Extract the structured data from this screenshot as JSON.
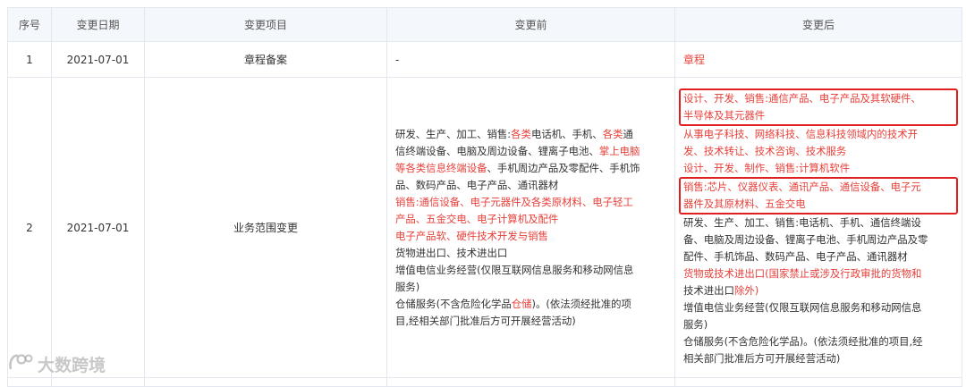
{
  "headers": [
    "序号",
    "变更日期",
    "变更项目",
    "变更前",
    "变更后"
  ],
  "rows": [
    {
      "index": "1",
      "date": "2021-07-01",
      "item": "章程备案",
      "before_text": "-",
      "after_text": "章程"
    },
    {
      "index": "2",
      "date": "2021-07-01",
      "item": "业务范围变更",
      "before": {
        "l1a": "研发、生产、加工、销售:",
        "l1b": "各类",
        "l1c": "电话机、手机、",
        "l1d": "各类",
        "l1e": "通",
        "l2a": "信终端设备、电脑及周边设备、锂离子电池、",
        "l2b": "掌上电脑",
        "l3a": "等各类信息终端设备",
        "l3b": "、手机周边产品及零配件、手机饰",
        "l4": "品、数码产品、电子产品、通讯器材",
        "l5": "销售:通信设备、电子元器件及各类原材料、电子轻工",
        "l6": "产品、五金交电、电子计算机及配件",
        "l7": "电子产品软、硬件技术开发与销售",
        "l8": "货物进出口、技术进出口",
        "l9": "增值电信业务经营(仅限互联网信息服务和移动网信息",
        "l10": "服务)",
        "l11a": "仓储服务(不含危险化学品",
        "l11b": "仓储",
        "l11c": ")。(依法须经批准的项",
        "l12": "目,经相关部门批准后方可开展经营活动)"
      },
      "after": {
        "box1_l1": "设计、开发、销售:通信产品、电子产品及其软硬件、",
        "box1_l2": "半导体及其元器件",
        "l3": "从事电子科技、网络科技、信息科技领域内的技术开",
        "l4": "发、技术转让、技术咨询、技术服务",
        "l5": "设计、开发、制作、销售:计算机软件",
        "box2_l1": "销售:芯片、仪器仪表、通讯产品、通信设备、电子元",
        "box2_l2": "器件及其原材料、五金交电",
        "l8": "研发、生产、加工、销售:电话机、手机、通信终端设",
        "l9": "备、电脑及周边设备、锂离子电池、手机周边产品及零",
        "l10": "配件、手机饰品、数码产品、电子产品、通讯器材",
        "l11": "货物或技术进出口(国家禁止或涉及行政审批的货物和",
        "l12a": "技术进出口",
        "l12b": "除外)",
        "l13": "增值电信业务经营(仅限互联网信息服务和移动网信息",
        "l14": "服务)",
        "l15": "仓储服务(不含危险化学品)。(依法须经批准的项目,经",
        "l16": "相关部门批准后方可开展经营活动)"
      }
    }
  ],
  "watermark": "大数跨境",
  "colors": {
    "highlight": "#e8403a",
    "box_border": "#e02020",
    "header_bg": "#f4f7fb",
    "border": "#e4e8ee"
  }
}
